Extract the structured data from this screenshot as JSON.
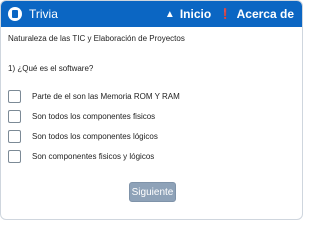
{
  "app": {
    "title": "Trivia"
  },
  "nav": {
    "home_label": "Inicio",
    "about_label": "Acerca de"
  },
  "quiz": {
    "subject": "Naturaleza de las TIC y Elaboración de Proyectos",
    "question": "1) ¿Qué es el software?",
    "options": [
      {
        "label": "Parte de el son las Memoria ROM Y RAM",
        "checked": false
      },
      {
        "label": "Son todos los componentes fisicos",
        "checked": false
      },
      {
        "label": "Son todos los componentes lógicos",
        "checked": false
      },
      {
        "label": "Son componentes fisicos y lógicos",
        "checked": false
      }
    ],
    "next_label": "Siguiente"
  },
  "colors": {
    "header": "#0b66c3",
    "button": "#8ea2b8"
  },
  "icons": {
    "app": "app-logo-icon",
    "home": "home-icon",
    "about": "info-icon"
  }
}
